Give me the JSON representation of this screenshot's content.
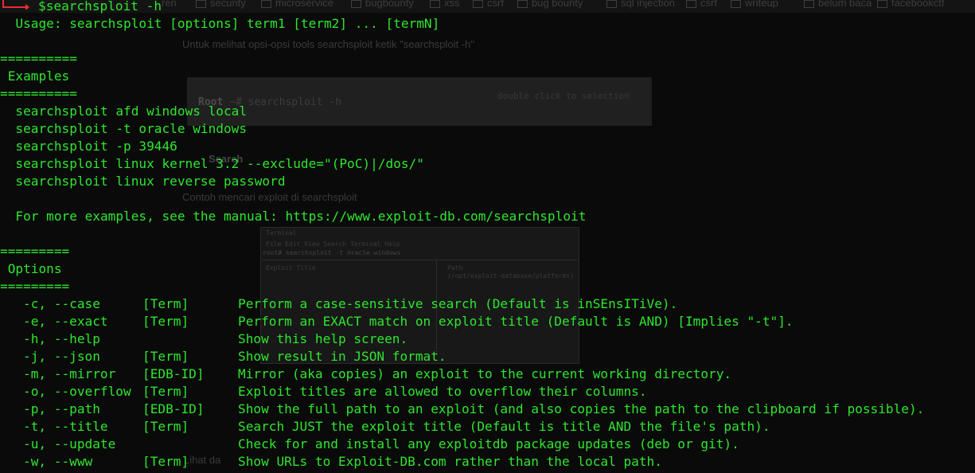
{
  "background_page": {
    "bookmarks": [
      "ren",
      "security",
      "microservice",
      "bugbounty",
      "xss",
      "csrf",
      "bug bounty",
      "sql injection",
      "csrf",
      "writeup",
      "belum baca",
      "facebookctf"
    ],
    "intro_text": "Untuk melihat opsi-opsi tools searchsploit ketik \"searchsploit -h\"",
    "code_prompt": "Root",
    "code_command": "~# searchsploit -h",
    "code_hint": "double click to selection",
    "section_heading": "Search",
    "example_text": "Contoh mencari exploit di searchsploit",
    "screenshot": {
      "title": "Terminal",
      "menu": "File  Edit  View  Search  Terminal  Help",
      "command": "root# searchsploit -t oracle windows",
      "col_title": "Exploit Title",
      "col_path": "Path",
      "col_path_sub": "(/opt/exploit-database/platforms)"
    },
    "bottom_text": "Lihat da"
  },
  "terminal": {
    "prompt_command": "$searchsploit -h",
    "usage": "  Usage: searchsploit [options] term1 [term2] ... [termN]",
    "separator_examples": "==========",
    "examples_heading": " Examples",
    "examples": [
      "  searchsploit afd windows local",
      "  searchsploit -t oracle windows",
      "  searchsploit -p 39446",
      "  searchsploit linux kernel 3.2 --exclude=\"(PoC)|/dos/\"",
      "  searchsploit linux reverse password"
    ],
    "more_examples": "  For more examples, see the manual: https://www.exploit-db.com/searchsploit",
    "separator_options": "=========",
    "options_heading": " Options",
    "options": [
      {
        "flag": "-c, --case",
        "arg": "[Term]",
        "desc": "Perform a case-sensitive search (Default is inSEnsITiVe)."
      },
      {
        "flag": "-e, --exact",
        "arg": "[Term]",
        "desc": "Perform an EXACT match on exploit title (Default is AND) [Implies \"-t\"]."
      },
      {
        "flag": "-h, --help",
        "arg": "",
        "desc": "Show this help screen."
      },
      {
        "flag": "-j, --json",
        "arg": "[Term]",
        "desc": "Show result in JSON format."
      },
      {
        "flag": "-m, --mirror",
        "arg": "[EDB-ID]",
        "desc": "Mirror (aka copies) an exploit to the current working directory."
      },
      {
        "flag": "-o, --overflow",
        "arg": "[Term]",
        "desc": "Exploit titles are allowed to overflow their columns."
      },
      {
        "flag": "-p, --path",
        "arg": "[EDB-ID]",
        "desc": "Show the full path to an exploit (and also copies the path to the clipboard if possible)."
      },
      {
        "flag": "-t, --title",
        "arg": "[Term]",
        "desc": "Search JUST the exploit title (Default is title AND the file's path)."
      },
      {
        "flag": "-u, --update",
        "arg": "",
        "desc": "Check for and install any exploitdb package updates (deb or git)."
      },
      {
        "flag": "-w, --www",
        "arg": "[Term]",
        "desc": "Show URLs to Exploit-DB.com rather than the local path."
      }
    ]
  },
  "colors": {
    "terminal_text": "#2ee62e",
    "prompt_arrow": "#e23030",
    "background": "#0a0a0a"
  }
}
